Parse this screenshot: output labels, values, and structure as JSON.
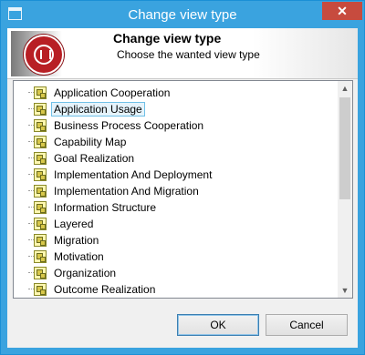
{
  "window": {
    "title": "Change view type",
    "close_label": "✕"
  },
  "banner": {
    "title": "Change view type",
    "subtitle": "Choose the wanted view type"
  },
  "list": {
    "selected_index": 1,
    "items": [
      {
        "label": "Application Cooperation"
      },
      {
        "label": "Application Usage"
      },
      {
        "label": "Business Process Cooperation"
      },
      {
        "label": "Capability Map"
      },
      {
        "label": "Goal Realization"
      },
      {
        "label": "Implementation And Deployment"
      },
      {
        "label": "Implementation And Migration"
      },
      {
        "label": "Information Structure"
      },
      {
        "label": "Layered"
      },
      {
        "label": "Migration"
      },
      {
        "label": "Motivation"
      },
      {
        "label": "Organization"
      },
      {
        "label": "Outcome Realization"
      }
    ],
    "scroll_up_icon": "▲",
    "scroll_down_icon": "▼"
  },
  "buttons": {
    "ok": "OK",
    "cancel": "Cancel"
  },
  "colors": {
    "titlebar": "#3aa3df",
    "close": "#c74b3e",
    "selection": "#e5f3fb"
  }
}
